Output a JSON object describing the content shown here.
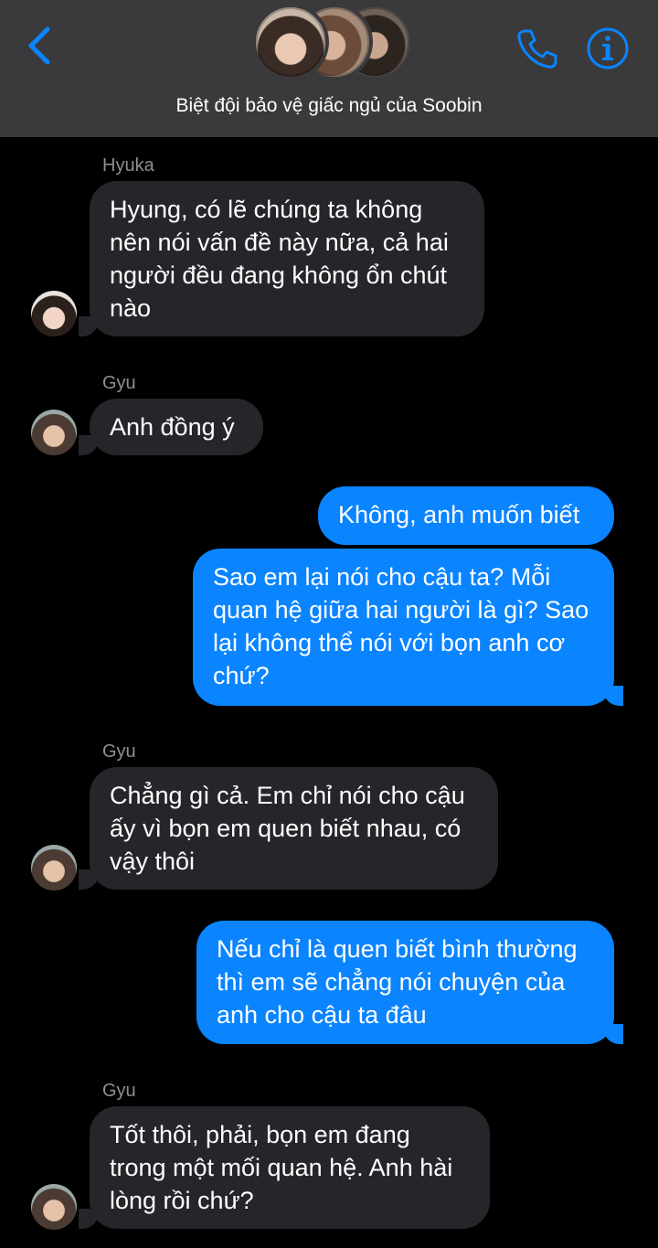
{
  "header": {
    "title": "Biệt đội bảo vệ giấc ngủ của Soobin",
    "icons": [
      "chevron-left-icon",
      "phone-icon",
      "info-icon"
    ],
    "accent_color": "#0a84ff"
  },
  "messages": [
    {
      "sender": "Hyuka",
      "direction": "incoming",
      "lines": [
        "Hyung, có lẽ chúng ta không",
        "nên nói vấn đề này nữa, cả hai",
        "người đều đang không ổn chút",
        "nào"
      ]
    },
    {
      "sender": "Gyu",
      "direction": "incoming",
      "lines": [
        "Anh đồng ý"
      ]
    },
    {
      "direction": "outgoing",
      "lines": [
        "Không, anh muốn biết"
      ]
    },
    {
      "direction": "outgoing",
      "lines": [
        "Sao em lại nói cho cậu ta? Mỗi",
        "quan hệ giữa hai người là gì? Sao",
        "lại không thể nói với bọn anh cơ",
        "chứ?"
      ]
    },
    {
      "sender": "Gyu",
      "direction": "incoming",
      "lines": [
        "Chẳng gì cả. Em chỉ nói cho cậu",
        "ấy vì bọn em quen biết nhau, có",
        "vậy thôi"
      ]
    },
    {
      "direction": "outgoing",
      "lines": [
        "Nếu chỉ là quen biết bình thường",
        "thì em sẽ chẳng nói chuyện của",
        "anh cho cậu ta đâu"
      ]
    },
    {
      "sender": "Gyu",
      "direction": "incoming",
      "lines": [
        "Tốt thôi, phải, bọn em đang",
        "trong một mối quan hệ. Anh hài",
        "lòng rồi chứ?"
      ]
    }
  ]
}
